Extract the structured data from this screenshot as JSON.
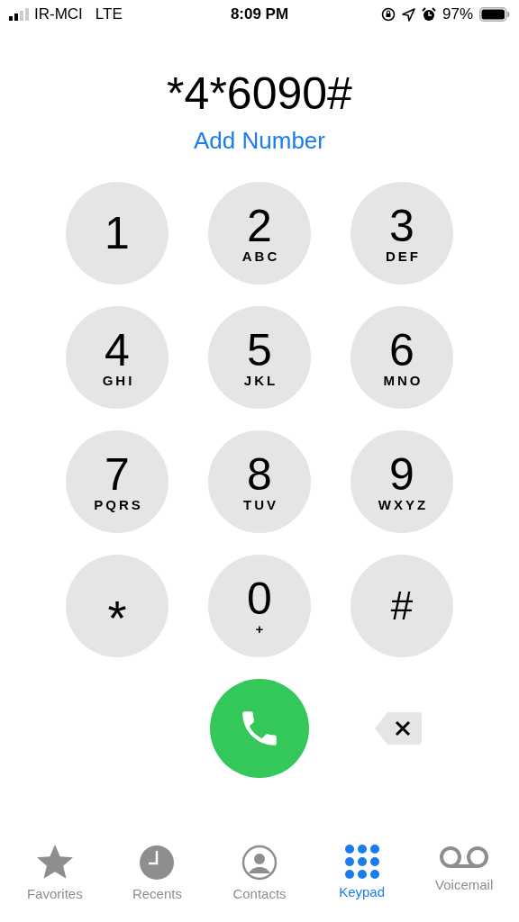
{
  "status_bar": {
    "carrier": "IR-MCI",
    "network": "LTE",
    "time": "8:09 PM",
    "battery": "97%"
  },
  "dialed_number": "*4*6090#",
  "add_number": "Add Number",
  "keys": [
    {
      "digit": "1"
    },
    {
      "digit": "2",
      "letters": "ABC"
    },
    {
      "digit": "3",
      "letters": "DEF"
    },
    {
      "digit": "4",
      "letters": "GHI"
    },
    {
      "digit": "5",
      "letters": "JKL"
    },
    {
      "digit": "6",
      "letters": "MNO"
    },
    {
      "digit": "7",
      "letters": "PQRS"
    },
    {
      "digit": "8",
      "letters": "TUV"
    },
    {
      "digit": "9",
      "letters": "WXYZ"
    },
    {
      "digit": "*",
      "kind": "asterisk"
    },
    {
      "digit": "0",
      "letters": "+"
    },
    {
      "digit": "#",
      "kind": "symbol"
    }
  ],
  "tabs": [
    {
      "label": "Favorites",
      "kind": "star",
      "selected": false
    },
    {
      "label": "Recents",
      "kind": "clock",
      "selected": false
    },
    {
      "label": "Contacts",
      "kind": "person",
      "selected": false
    },
    {
      "label": "Keypad",
      "kind": "keypad",
      "selected": true
    },
    {
      "label": "Voicemail",
      "kind": "voicemail",
      "selected": false
    }
  ]
}
